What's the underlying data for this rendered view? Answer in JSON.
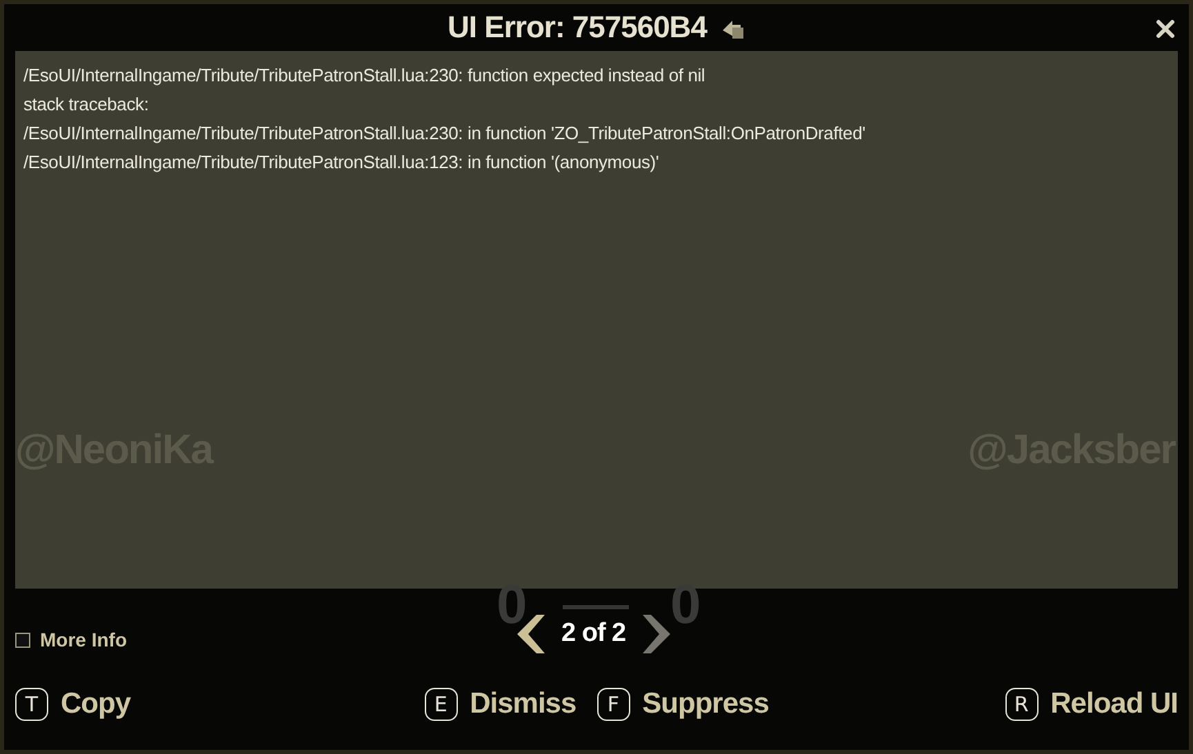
{
  "window": {
    "title": "UI Error: 757560B4"
  },
  "error_lines": [
    "/EsoUI/InternalIngame/Tribute/TributePatronStall.lua:230: function expected instead of nil",
    "stack traceback:",
    "/EsoUI/InternalIngame/Tribute/TributePatronStall.lua:230: in function 'ZO_TributePatronStall:OnPatronDrafted'",
    "/EsoUI/InternalIngame/Tribute/TributePatronStall.lua:123: in function '(anonymous)'"
  ],
  "background_names": [
    "@NeoniKa",
    "@Jacksber"
  ],
  "background_scores": [
    "0",
    "0"
  ],
  "more_info": {
    "label": "More Info",
    "checked": false
  },
  "pager": {
    "text": "2 of 2",
    "prev_disabled": false,
    "next_disabled": true
  },
  "actions": [
    {
      "key": "T",
      "label": "Copy"
    },
    {
      "key": "E",
      "label": "Dismiss"
    },
    {
      "key": "F",
      "label": "Suppress"
    },
    {
      "key": "R",
      "label": "Reload UI"
    }
  ]
}
